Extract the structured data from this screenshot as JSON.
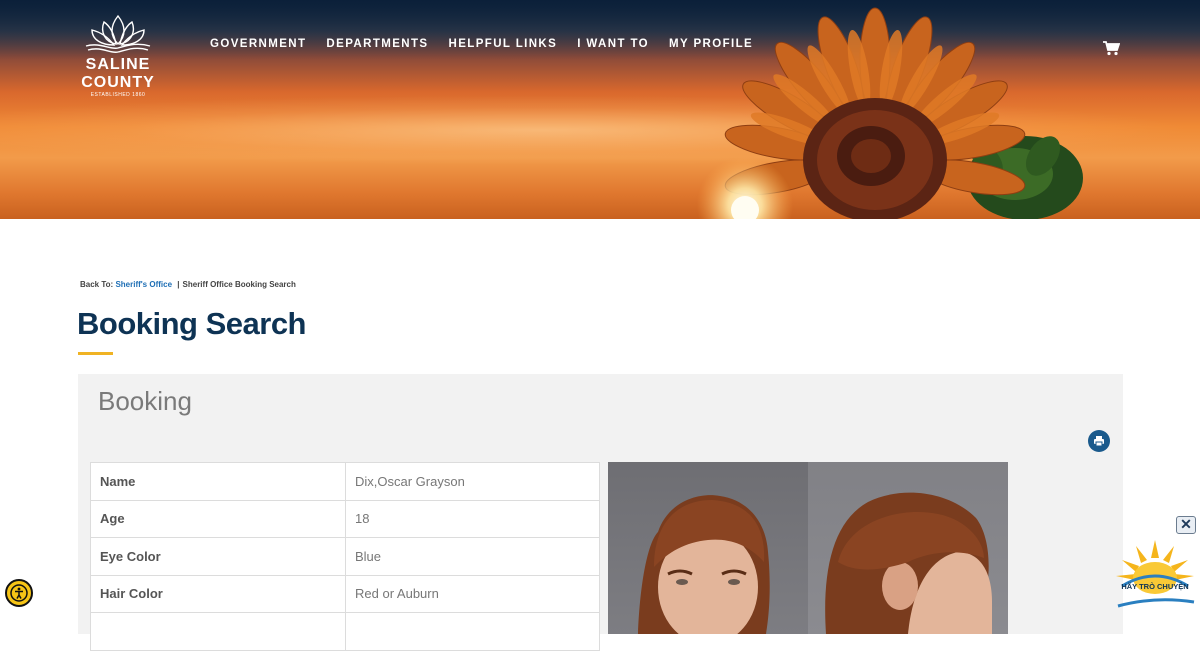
{
  "header": {
    "logo": {
      "line1": "SALINE",
      "line2": "COUNTY",
      "established": "ESTABLISHED 1860"
    },
    "nav": [
      "GOVERNMENT",
      "DEPARTMENTS",
      "HELPFUL LINKS",
      "I WANT TO",
      "MY PROFILE"
    ],
    "cart_icon": "shopping-cart-icon"
  },
  "breadcrumb": {
    "prefix": "Back To:",
    "link": "Sheriff's Office",
    "separator": "|",
    "current": "Sheriff Office Booking Search"
  },
  "page_title": "Booking Search",
  "panel": {
    "title": "Booking",
    "print_icon": "print-icon",
    "rows": [
      {
        "label": "Name",
        "value": "Dix,Oscar Grayson"
      },
      {
        "label": "Age",
        "value": "18"
      },
      {
        "label": "Eye Color",
        "value": "Blue"
      },
      {
        "label": "Hair Color",
        "value": "Red or Auburn"
      },
      {
        "label": "",
        "value": ""
      }
    ]
  },
  "widgets": {
    "accessibility_icon": "accessibility-icon",
    "chat_label": "HÃY TRÒ CHUYỆN",
    "chat_close": "✕"
  },
  "colors": {
    "title": "#0e3354",
    "accent": "#f0b323",
    "link": "#1f6fb5",
    "print_button": "#1a5a8c"
  }
}
